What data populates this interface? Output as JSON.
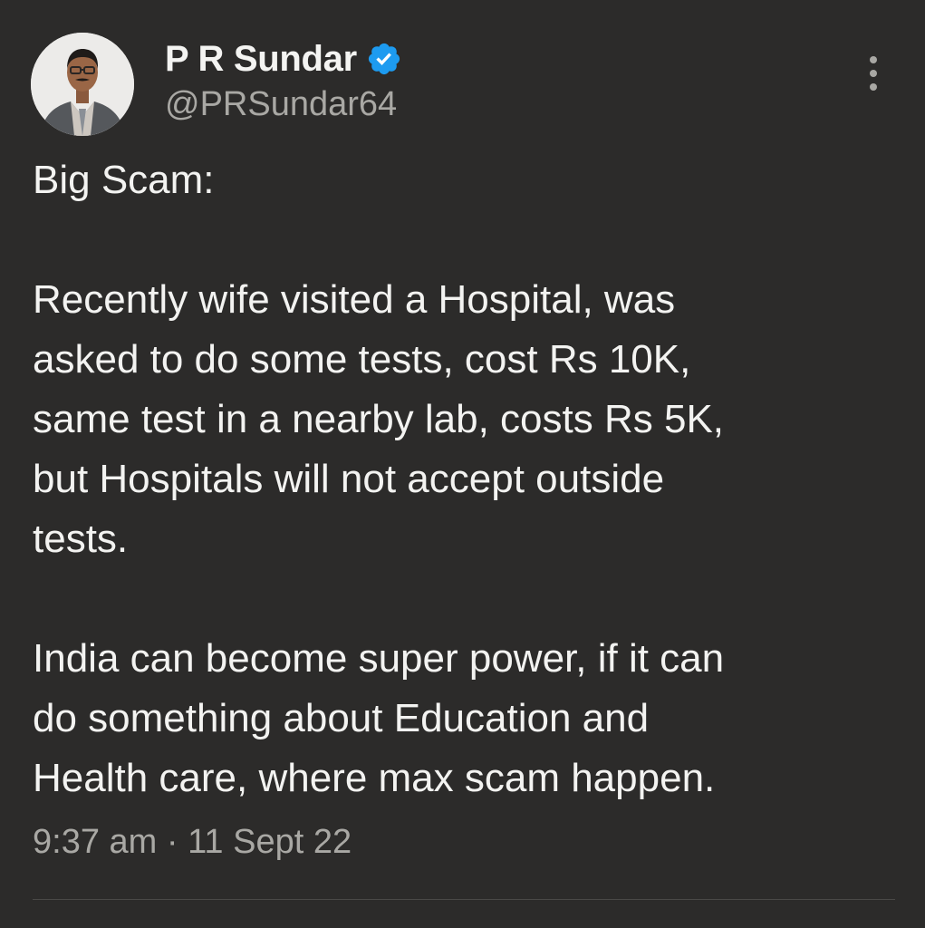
{
  "author": {
    "name": "P R Sundar",
    "handle": "@PRSundar64",
    "verified": true,
    "avatar_icon": "person-avatar"
  },
  "menu": {
    "icon": "more-vertical-icon"
  },
  "tweet": {
    "paragraphs": [
      "Big Scam:",
      "Recently wife visited a Hospital, was\nasked to do some tests, cost Rs 10K,\nsame test in a nearby lab, costs Rs 5K,\nbut Hospitals will not accept outside\ntests.",
      "India can become super power, if it can\ndo something about Education and\nHealth care, where max scam happen."
    ]
  },
  "meta": {
    "time": "9:37 am",
    "separator": " · ",
    "date": "11 Sept 22"
  },
  "colors": {
    "background": "#2c2b2a",
    "text": "#f3f3f1",
    "muted": "#a9a8a4",
    "verified": "#1d9bf0"
  }
}
